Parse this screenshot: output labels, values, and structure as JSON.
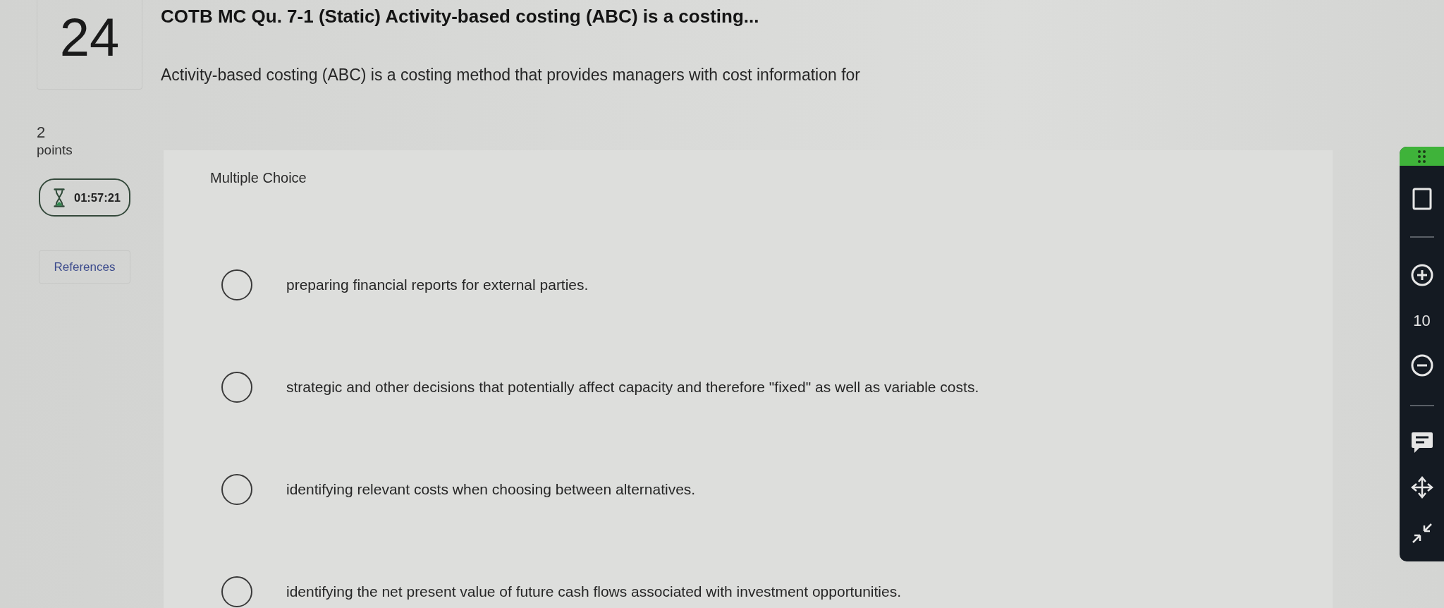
{
  "question": {
    "number": "24",
    "points": "2",
    "points_label": "points",
    "timer": "01:57:21",
    "references": "References"
  },
  "title": "COTB MC Qu. 7-1 (Static) Activity-based costing (ABC) is a costing...",
  "prompt": "Activity-based costing (ABC) is a costing method that provides managers with cost information for",
  "answer_panel": {
    "type_label": "Multiple Choice",
    "options": [
      {
        "text": "preparing financial reports for external parties.",
        "selected": false
      },
      {
        "text": "strategic and other decisions that potentially affect capacity and therefore \"fixed\" as well as variable costs.",
        "selected": false
      },
      {
        "text": "identifying relevant costs when choosing between alternatives.",
        "selected": false
      },
      {
        "text": "identifying the net present value of future cash flows associated with investment opportunities.",
        "selected": false
      }
    ]
  },
  "toolbar": {
    "zoom_level": "10"
  }
}
